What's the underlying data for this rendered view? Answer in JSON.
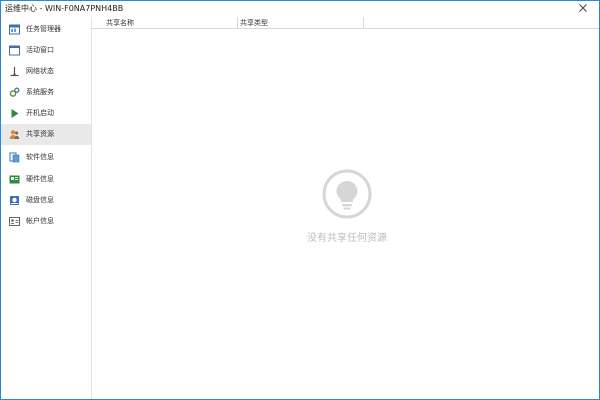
{
  "window": {
    "title": "运维中心 - WIN-F0NA7PNH4BB"
  },
  "sidebar": {
    "items": [
      {
        "label": "任务管理器",
        "icon": "task-manager-icon"
      },
      {
        "label": "活动窗口",
        "icon": "window-icon"
      },
      {
        "label": "网络状态",
        "icon": "network-icon"
      },
      {
        "label": "系统服务",
        "icon": "gear-icon"
      },
      {
        "label": "开机启动",
        "icon": "play-icon"
      },
      {
        "label": "共享资源",
        "icon": "users-icon"
      },
      {
        "label": "软件信息",
        "icon": "software-icon"
      },
      {
        "label": "硬件信息",
        "icon": "hardware-icon"
      },
      {
        "label": "磁盘信息",
        "icon": "disk-icon"
      },
      {
        "label": "帐户信息",
        "icon": "account-icon"
      }
    ],
    "active_index": 5
  },
  "table": {
    "columns": [
      "共享名称",
      "共享类型"
    ],
    "rows": []
  },
  "empty_state": {
    "message": "没有共享任何资源",
    "icon": "lightbulb-icon"
  },
  "colors": {
    "accent": "#2b88d8",
    "active_bg": "#e9e9e9",
    "empty_text": "#bdbdbd"
  }
}
